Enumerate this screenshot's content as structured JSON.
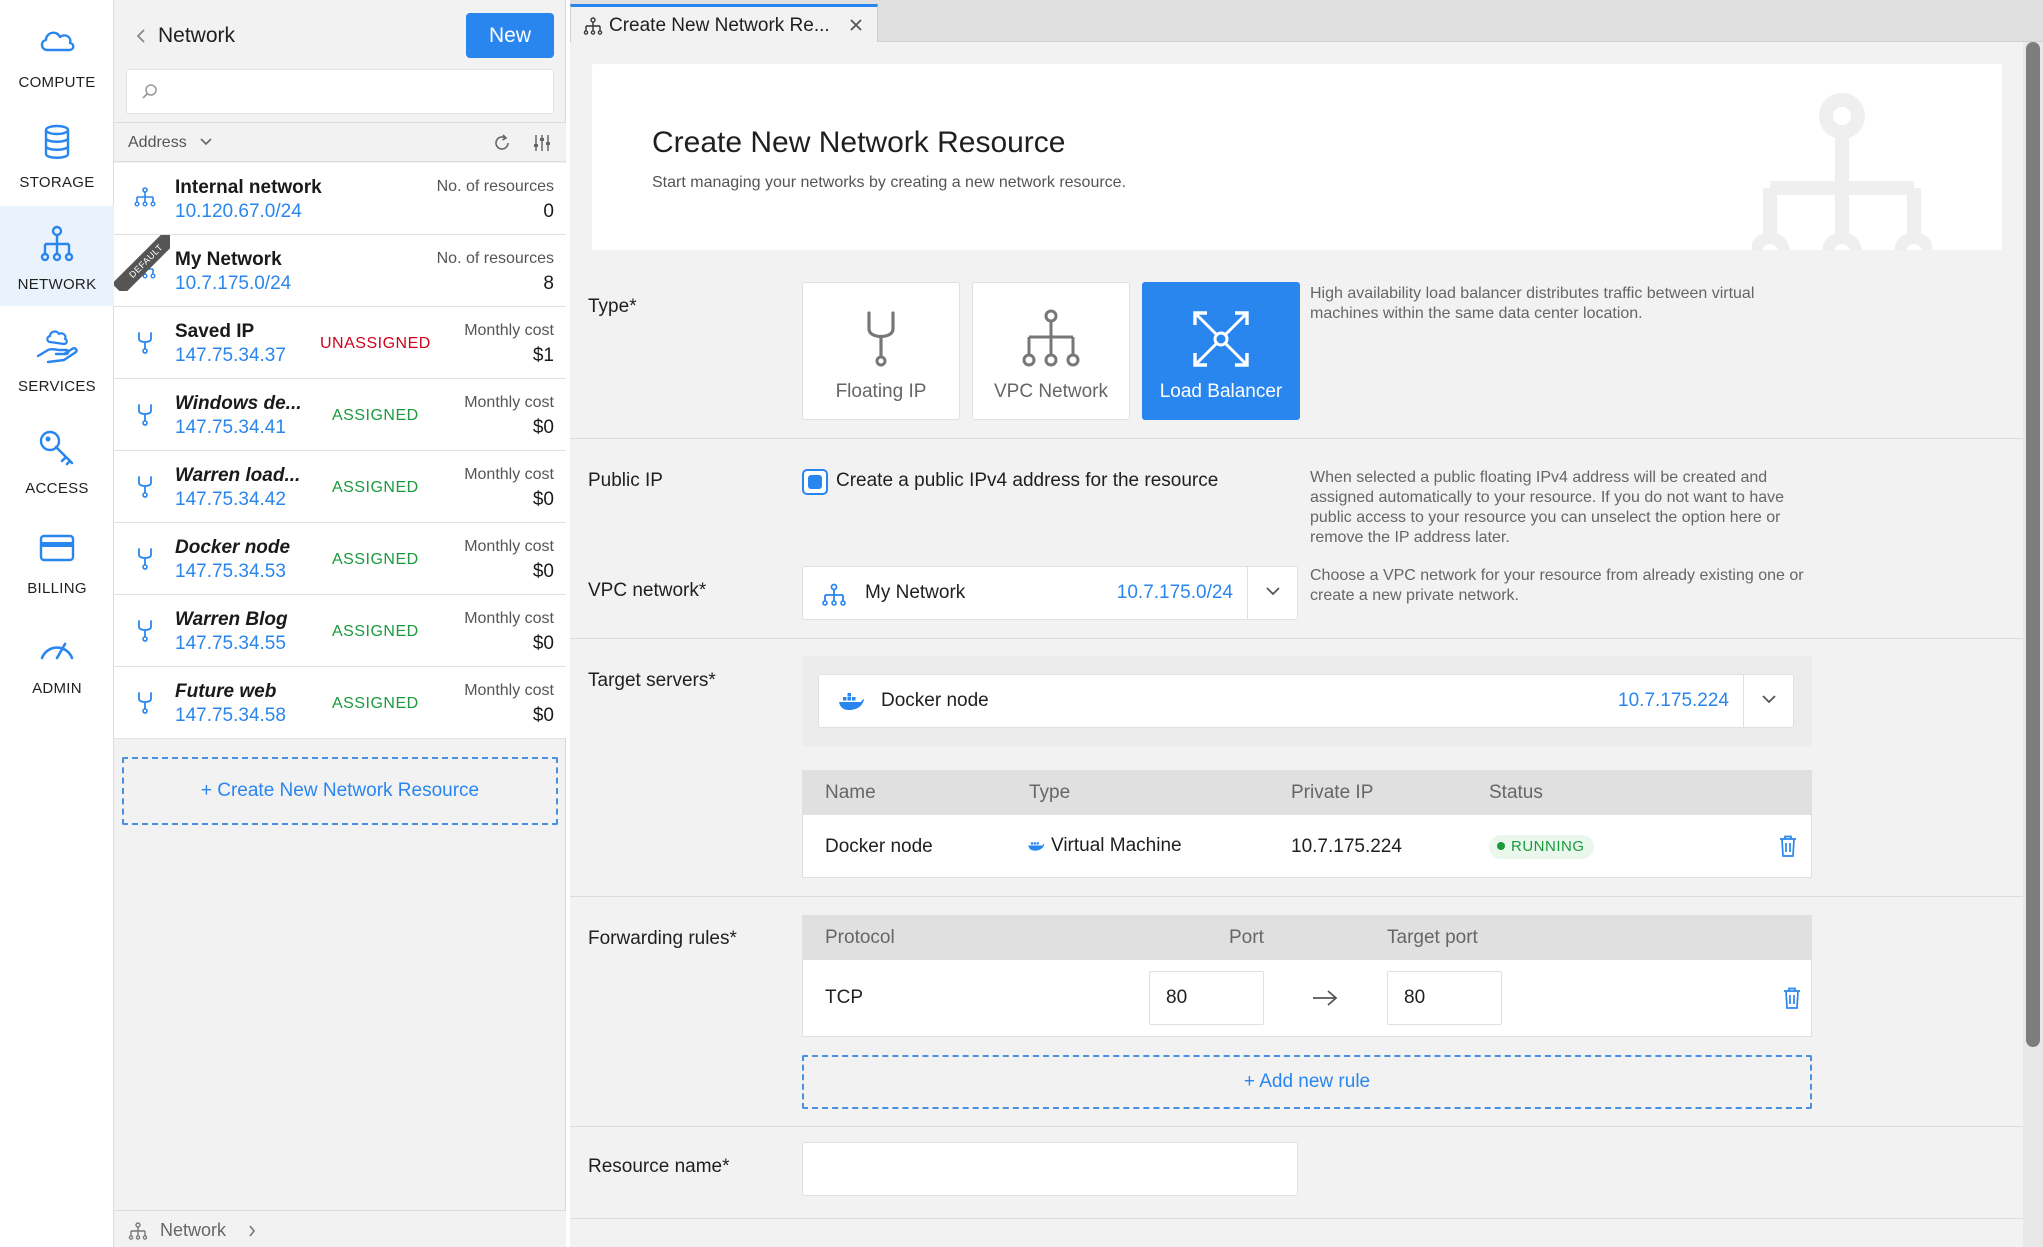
{
  "nav": {
    "items": [
      {
        "label": "COMPUTE",
        "icon": "cloud-icon"
      },
      {
        "label": "STORAGE",
        "icon": "database-icon"
      },
      {
        "label": "NETWORK",
        "icon": "network-icon"
      },
      {
        "label": "SERVICES",
        "icon": "hand-services-icon"
      },
      {
        "label": "ACCESS",
        "icon": "key-icon"
      },
      {
        "label": "BILLING",
        "icon": "credit-card-icon"
      },
      {
        "label": "ADMIN",
        "icon": "gauge-icon"
      }
    ],
    "active": "NETWORK"
  },
  "list_panel": {
    "title": "Network",
    "new_label": "New",
    "search_placeholder": "",
    "sort_label": "Address",
    "create_link": "+ Create New Network Resource",
    "footer": "Network",
    "ribbon": "DEFAULT",
    "rows": [
      {
        "name": "Internal network",
        "address": "10.120.67.0/24",
        "meta": "No. of resources",
        "value": "0",
        "status": "",
        "icon": "network-icon"
      },
      {
        "name": "My Network",
        "address": "10.7.175.0/24",
        "meta": "No. of resources",
        "value": "8",
        "status": "",
        "icon": "network-icon"
      },
      {
        "name": "Saved IP",
        "address": "147.75.34.37",
        "meta": "Monthly cost",
        "value": "$1",
        "status": "UNASSIGNED",
        "icon": "fork-icon"
      },
      {
        "name": "Windows de...",
        "address": "147.75.34.41",
        "meta": "Monthly cost",
        "value": "$0",
        "status": "ASSIGNED",
        "icon": "fork-icon"
      },
      {
        "name": "Warren load...",
        "address": "147.75.34.42",
        "meta": "Monthly cost",
        "value": "$0",
        "status": "ASSIGNED",
        "icon": "fork-icon"
      },
      {
        "name": "Docker node",
        "address": "147.75.34.53",
        "meta": "Monthly cost",
        "value": "$0",
        "status": "ASSIGNED",
        "icon": "fork-icon"
      },
      {
        "name": "Warren Blog",
        "address": "147.75.34.55",
        "meta": "Monthly cost",
        "value": "$0",
        "status": "ASSIGNED",
        "icon": "fork-icon"
      },
      {
        "name": "Future web",
        "address": "147.75.34.58",
        "meta": "Monthly cost",
        "value": "$0",
        "status": "ASSIGNED",
        "icon": "fork-icon"
      }
    ]
  },
  "tab": {
    "label": "Create New Network Re..."
  },
  "form": {
    "title": "Create New Network Resource",
    "subtitle": "Start managing your networks by creating a new network resource.",
    "type": {
      "label": "Type*",
      "options": [
        "Floating IP",
        "VPC Network",
        "Load Balancer"
      ],
      "selected": "Load Balancer",
      "help": "High availability load balancer distributes traffic between virtual machines within the same data center location."
    },
    "public_ip": {
      "label": "Public IP",
      "checkbox_label": "Create a public IPv4 address for the resource",
      "checked": true,
      "help": "When selected a public floating IPv4 address will be created and assigned automatically to your resource. If you do not want to have public access to your resource you can unselect the option here or remove the IP address later."
    },
    "vpc": {
      "label": "VPC network*",
      "selected_name": "My Network",
      "selected_cidr": "10.7.175.0/24",
      "help": "Choose a VPC network for your resource from already existing one or create a new private network."
    },
    "target": {
      "label": "Target servers*",
      "selected_name": "Docker node",
      "selected_ip": "10.7.175.224",
      "columns": [
        "Name",
        "Type",
        "Private IP",
        "Status"
      ],
      "rows": [
        {
          "name": "Docker node",
          "type": "Virtual Machine",
          "ip": "10.7.175.224",
          "status": "RUNNING"
        }
      ]
    },
    "forwarding": {
      "label": "Forwarding rules*",
      "columns": [
        "Protocol",
        "Port",
        "Target port"
      ],
      "rows": [
        {
          "protocol": "TCP",
          "port": "80",
          "target_port": "80"
        }
      ],
      "add_label": "+ Add new rule"
    },
    "resource_name": {
      "label": "Resource name*",
      "value": ""
    }
  },
  "colors": {
    "accent": "#2a86ef",
    "assigned": "#1b9a3c",
    "unassigned": "#d0021b"
  }
}
